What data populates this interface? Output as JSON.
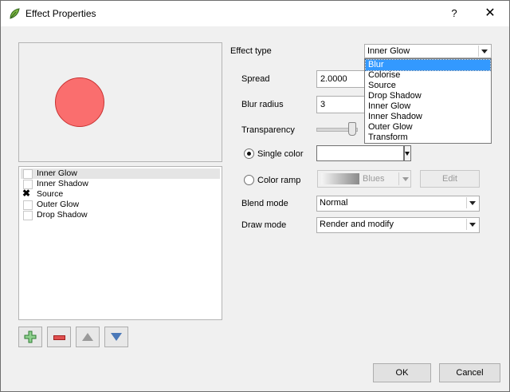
{
  "window": {
    "title": "Effect Properties",
    "help_label": "?",
    "close_label": "✕"
  },
  "effects_list": {
    "items": [
      {
        "label": "Inner Glow",
        "checked": false,
        "selected": true
      },
      {
        "label": "Inner Shadow",
        "checked": false,
        "selected": false
      },
      {
        "label": "Source",
        "checked": true,
        "selected": false
      },
      {
        "label": "Outer Glow",
        "checked": false,
        "selected": false
      },
      {
        "label": "Drop Shadow",
        "checked": false,
        "selected": false
      }
    ],
    "check_mark": "✖"
  },
  "form": {
    "effect_type_label": "Effect type",
    "effect_type_value": "Inner Glow",
    "effect_type_options": [
      "Blur",
      "Colorise",
      "Source",
      "Drop Shadow",
      "Inner Glow",
      "Inner Shadow",
      "Outer Glow",
      "Transform"
    ],
    "effect_type_highlighted": "Blur",
    "spread_label": "Spread",
    "spread_value": "2.0000",
    "blur_radius_label": "Blur radius",
    "blur_radius_value": "3",
    "transparency_label": "Transparency",
    "transparency_level": 0.8,
    "single_color_label": "Single color",
    "single_color_value": "#ffffff",
    "color_ramp_label": "Color ramp",
    "color_ramp_value": "Blues",
    "edit_label": "Edit",
    "blend_mode_label": "Blend mode",
    "blend_mode_value": "Normal",
    "draw_mode_label": "Draw mode",
    "draw_mode_value": "Render and modify"
  },
  "buttons": {
    "ok_label": "OK",
    "cancel_label": "Cancel"
  },
  "colors": {
    "preview_circle_fill": "#fa6e6e",
    "highlight": "#3399ff"
  }
}
